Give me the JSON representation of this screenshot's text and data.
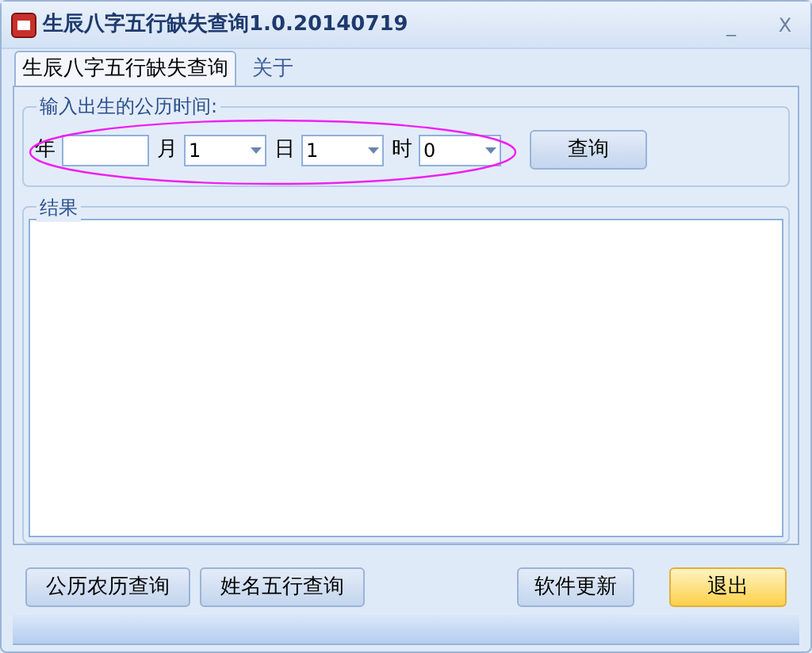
{
  "window": {
    "title": "生辰八字五行缺失查询1.0.20140719",
    "controls": [
      "_",
      "X"
    ]
  },
  "tabs": [
    {
      "label": "生辰八字五行缺失查询",
      "selected": true
    },
    {
      "label": "关于",
      "selected": false
    }
  ],
  "input_group": {
    "title": "输入出生的公历时间:",
    "fields": [
      {
        "label": "年",
        "kind": "text"
      },
      {
        "label": "月",
        "kind": "dropdown",
        "value": "1"
      },
      {
        "label": "日",
        "kind": "dropdown",
        "value": "1"
      },
      {
        "label": "时",
        "kind": "dropdown",
        "value": "0"
      }
    ],
    "button": "查询",
    "circled": true
  },
  "result_group": {
    "title": "结果"
  },
  "buttons": [
    {
      "label": "公历农历查询",
      "primary": false
    },
    {
      "label": "姓名五行查询",
      "primary": false
    },
    {
      "label": "软件更新",
      "primary": false
    },
    {
      "label": "退出",
      "primary": true
    }
  ]
}
